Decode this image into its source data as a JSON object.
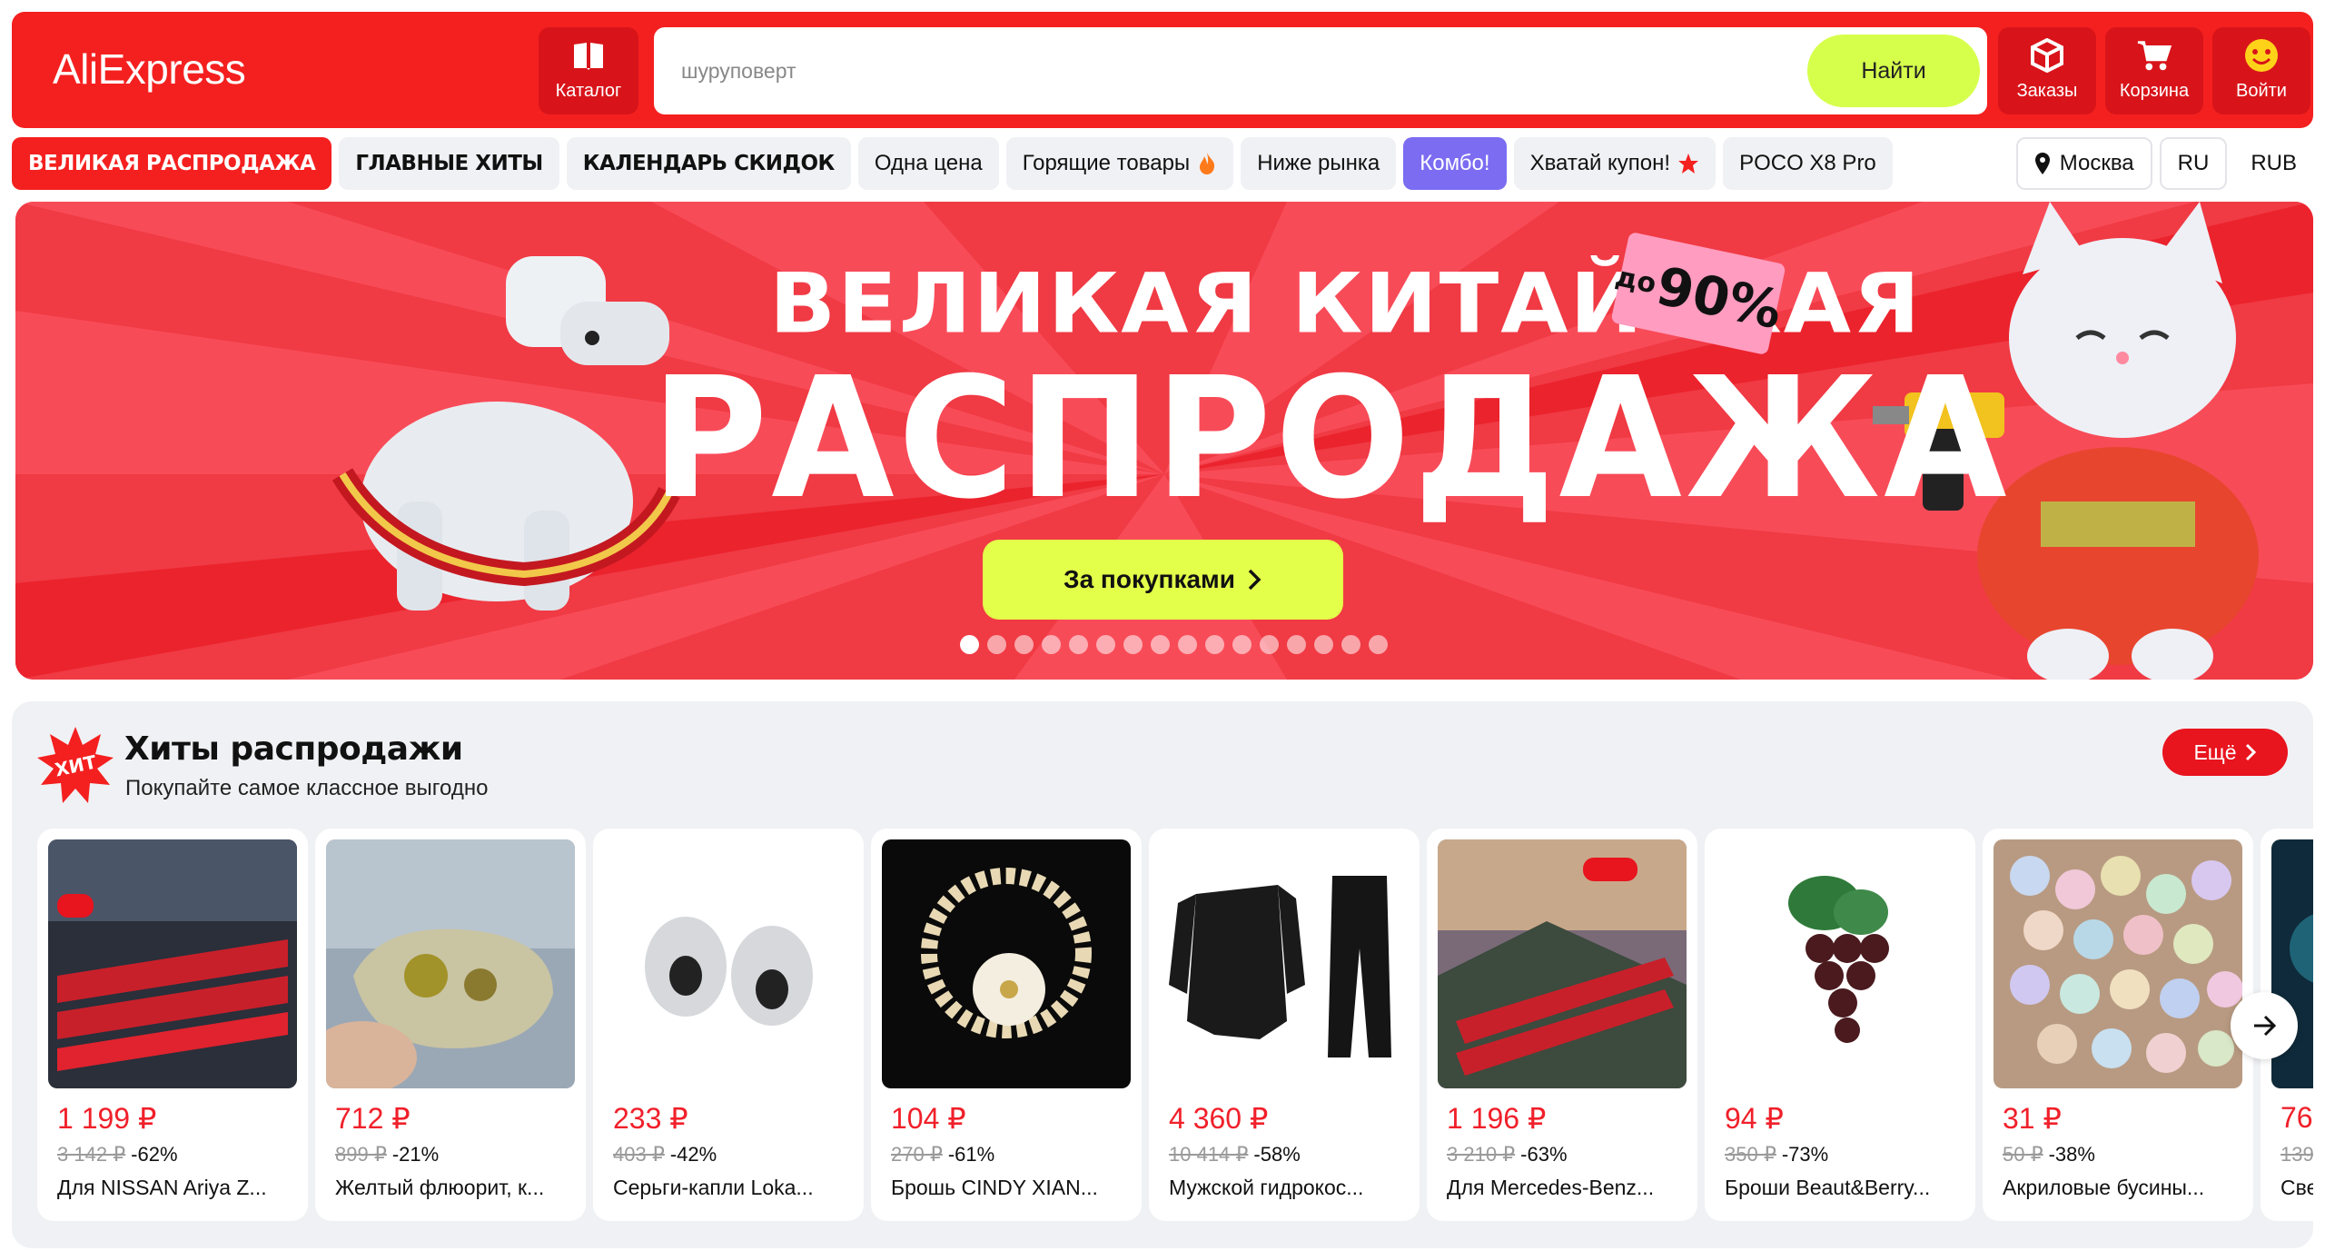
{
  "header": {
    "logo": "AliExpress",
    "catalog_label": "Каталог",
    "search": {
      "value": "шуруповерт",
      "button": "Найти"
    },
    "orders_label": "Заказы",
    "cart_label": "Корзина",
    "login_label": "Войти"
  },
  "nav": {
    "items": [
      "ВЕЛИКАЯ РАСПРОДАЖА",
      "ГЛАВНЫЕ ХИТЫ",
      "КАЛЕНДАРЬ СКИДОК",
      "Одна цена",
      "Горящие товары",
      "Ниже рынка",
      "Комбо!",
      "Хватай купон!",
      "POCO X8 Pro"
    ],
    "city": "Москва",
    "lang": "RU",
    "currency": "RUB"
  },
  "banner": {
    "title_line1": "ВЕЛИКАЯ КИТАЙСКАЯ",
    "title_line2": "РАСПРОДАЖА",
    "badge_prefix": "до",
    "badge_value": "90%",
    "button": "За покупками",
    "slides_count": 16,
    "active_slide": 1
  },
  "hits": {
    "badge": "ХИТ",
    "title": "Хиты распродажи",
    "subtitle": "Покупайте самое классное выгодно",
    "more": "Ещё",
    "products": [
      {
        "price": "1 199 ₽",
        "old_price": "3 142 ₽",
        "discount": "-62%",
        "name": "Для NISSAN Ariya Z..."
      },
      {
        "price": "712 ₽",
        "old_price": "899 ₽",
        "discount": "-21%",
        "name": "Желтый флюорит, к..."
      },
      {
        "price": "233 ₽",
        "old_price": "403 ₽",
        "discount": "-42%",
        "name": "Серьги-капли Loka..."
      },
      {
        "price": "104 ₽",
        "old_price": "270 ₽",
        "discount": "-61%",
        "name": "Брошь CINDY XIAN..."
      },
      {
        "price": "4 360 ₽",
        "old_price": "10 414 ₽",
        "discount": "-58%",
        "name": "Мужской гидрокос..."
      },
      {
        "price": "1 196 ₽",
        "old_price": "3 210 ₽",
        "discount": "-63%",
        "name": "Для Mercedes-Benz..."
      },
      {
        "price": "94 ₽",
        "old_price": "350 ₽",
        "discount": "-73%",
        "name": "Броши Beaut&Berry..."
      },
      {
        "price": "31 ₽",
        "old_price": "50 ₽",
        "discount": "-38%",
        "name": "Акриловые бусины..."
      },
      {
        "price": "76",
        "old_price": "139",
        "discount": "",
        "name": "Све"
      }
    ]
  },
  "colors": {
    "brand_red": "#f4201f",
    "accent_lime": "#d6ff4c",
    "combo_purple": "#7b6cf2"
  }
}
